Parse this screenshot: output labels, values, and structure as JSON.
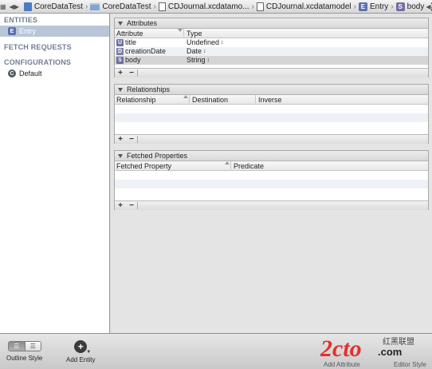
{
  "jumpbar": {
    "crumbs": [
      {
        "label": "CoreDataTest",
        "icon": "project-icon"
      },
      {
        "label": "CoreDataTest",
        "icon": "folder-icon"
      },
      {
        "label": "CDJournal.xcdatamo...",
        "icon": "document-icon"
      },
      {
        "label": "CDJournal.xcdatamodel",
        "icon": "document-icon"
      },
      {
        "label": "Entry",
        "icon": "entity-icon",
        "badge": "E"
      },
      {
        "label": "body",
        "icon": "string-icon",
        "badge": "S"
      }
    ],
    "warning_badge": "!"
  },
  "sidebar": {
    "entities_header": "ENTITIES",
    "entities": [
      {
        "label": "Entry",
        "badge": "E",
        "selected": true
      }
    ],
    "fetch_requests_header": "FETCH REQUESTS",
    "configurations_header": "CONFIGURATIONS",
    "configurations": [
      {
        "label": "Default",
        "badge": "C"
      }
    ]
  },
  "attributes": {
    "title": "Attributes",
    "col_attribute": "Attribute",
    "col_type": "Type",
    "rows": [
      {
        "badge": "U",
        "name": "title",
        "type": "Undefined"
      },
      {
        "badge": "D",
        "name": "creationDate",
        "type": "Date"
      },
      {
        "badge": "S",
        "name": "body",
        "type": "String"
      }
    ],
    "add": "+",
    "remove": "−"
  },
  "relationships": {
    "title": "Relationships",
    "col_relationship": "Relationship",
    "col_destination": "Destination",
    "col_inverse": "Inverse",
    "add": "+",
    "remove": "−"
  },
  "fetched_properties": {
    "title": "Fetched Properties",
    "col_fetched_property": "Fetched Property",
    "col_predicate": "Predicate",
    "add": "+",
    "remove": "−"
  },
  "bottombar": {
    "outline_style_label": "Outline Style",
    "add_entity_label": "Add Entity",
    "add_entity_glyph": "+",
    "add_attribute_label": "Add Attribute",
    "editor_style_label": "Editor Style",
    "watermark_text": "2cto",
    "watermark_sub": ".com",
    "watermark_cn": "红黑联盟"
  },
  "colors": {
    "selection": "#b9c6d8",
    "header_text": "#6f7e94",
    "warning": "#cc2020",
    "watermark": "#e0312f"
  }
}
